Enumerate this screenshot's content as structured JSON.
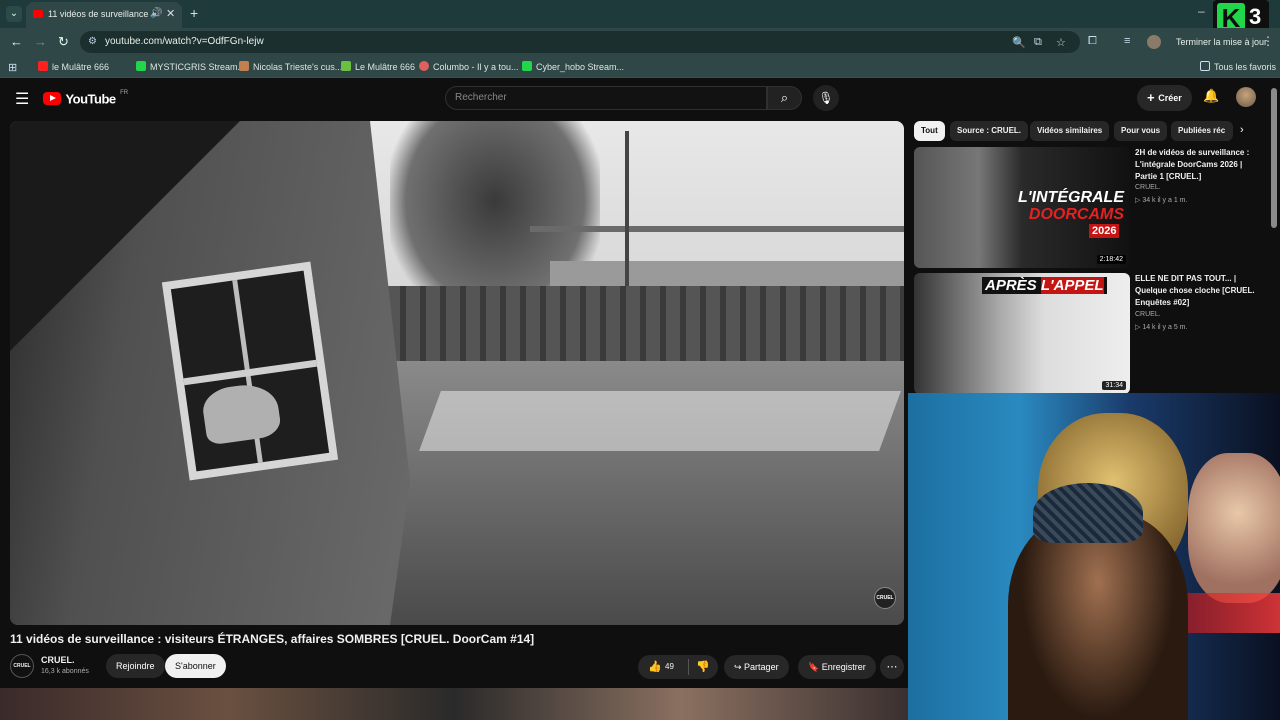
{
  "browser": {
    "tab_title": "11 vidéos de surveillance : v",
    "url": "youtube.com/watch?v=OdfFGn-lejw",
    "update_label": "Terminer la mise à jour",
    "bookmarks": [
      "le Mulâtre 666",
      "MYSTICGRIS Stream...",
      "Nicolas Trieste's cus...",
      "Le Mulâtre 666",
      "Columbo - Il y a tou...",
      "Cyber_hobo Stream..."
    ],
    "all_bookmarks": "Tous les favoris"
  },
  "overlay": {
    "logo_number": "3"
  },
  "youtube": {
    "logo_text": "YouTube",
    "country": "FR",
    "search_placeholder": "Rechercher",
    "create_label": "Créer"
  },
  "video": {
    "watermark": "CRUEL",
    "title": "11 vidéos de surveillance : visiteurs ÉTRANGES, affaires SOMBRES [CRUEL. DoorCam #14]",
    "channel": "CRUEL.",
    "channel_avatar": "CRUEL",
    "subscribers": "16,3 k abonnés",
    "join_label": "Rejoindre",
    "subscribe_label": "S'abonner",
    "likes": "49",
    "share_label": "Partager",
    "save_label": "Enregistrer"
  },
  "chips": [
    "Tout",
    "Source : CRUEL.",
    "Vidéos similaires",
    "Pour vous",
    "Publiées réc"
  ],
  "recommendations": [
    {
      "title": "2H de vidéos de surveillance : L'intégrale DoorCams 2026 | Partie 1 [CRUEL.]",
      "channel": "CRUEL.",
      "meta": "34 k  il y a 1 m.",
      "duration": "2:18:42",
      "thumb_line1": "L'INTÉGRALE",
      "thumb_line2": "DOORCAMS",
      "thumb_badge": "2026"
    },
    {
      "title": "ELLE NE DIT PAS TOUT... | Quelque chose cloche [CRUEL. Enquêtes #02]",
      "channel": "CRUEL.",
      "meta": "14 k  il y a 5 m.",
      "duration": "31:34",
      "thumb_line1": "APRÈS",
      "thumb_line2": "L'APPEL"
    }
  ]
}
